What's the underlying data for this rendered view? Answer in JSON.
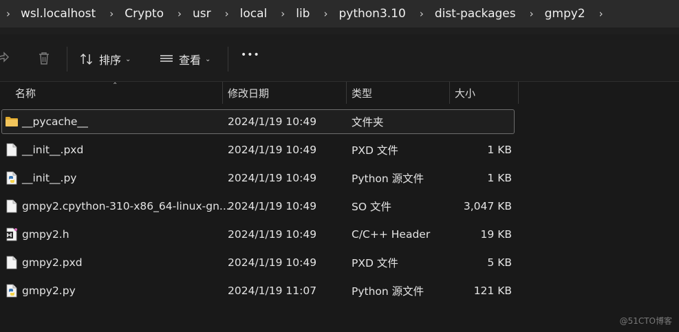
{
  "breadcrumb": {
    "items": [
      "wsl.localhost",
      "Crypto",
      "usr",
      "local",
      "lib",
      "python3.10",
      "dist-packages",
      "gmpy2"
    ]
  },
  "toolbar": {
    "sort_label": "排序",
    "view_label": "查看",
    "more_label": "•••"
  },
  "columns": {
    "name": "名称",
    "date": "修改日期",
    "type": "类型",
    "size": "大小"
  },
  "files": [
    {
      "name": "__pycache__",
      "date": "2024/1/19 10:49",
      "type": "文件夹",
      "size": "",
      "icon": "folder-icon"
    },
    {
      "name": "__init__.pxd",
      "date": "2024/1/19 10:49",
      "type": "PXD 文件",
      "size": "1 KB",
      "icon": "file-icon"
    },
    {
      "name": "__init__.py",
      "date": "2024/1/19 10:49",
      "type": "Python 源文件",
      "size": "1 KB",
      "icon": "python-file-icon"
    },
    {
      "name": "gmpy2.cpython-310-x86_64-linux-gn...",
      "date": "2024/1/19 10:49",
      "type": "SO 文件",
      "size": "3,047 KB",
      "icon": "file-icon"
    },
    {
      "name": "gmpy2.h",
      "date": "2024/1/19 10:49",
      "type": "C/C++ Header",
      "size": "19 KB",
      "icon": "header-file-icon"
    },
    {
      "name": "gmpy2.pxd",
      "date": "2024/1/19 10:49",
      "type": "PXD 文件",
      "size": "5 KB",
      "icon": "file-icon"
    },
    {
      "name": "gmpy2.py",
      "date": "2024/1/19 11:07",
      "type": "Python 源文件",
      "size": "121 KB",
      "icon": "python-file-icon"
    }
  ],
  "watermark": "@51CTO博客",
  "colors": {
    "background": "#191919",
    "breadcrumb_bg": "#2b2b2b",
    "folder": "#f2c55c",
    "python_blue": "#3a78b5",
    "python_yellow": "#f5d44a"
  }
}
